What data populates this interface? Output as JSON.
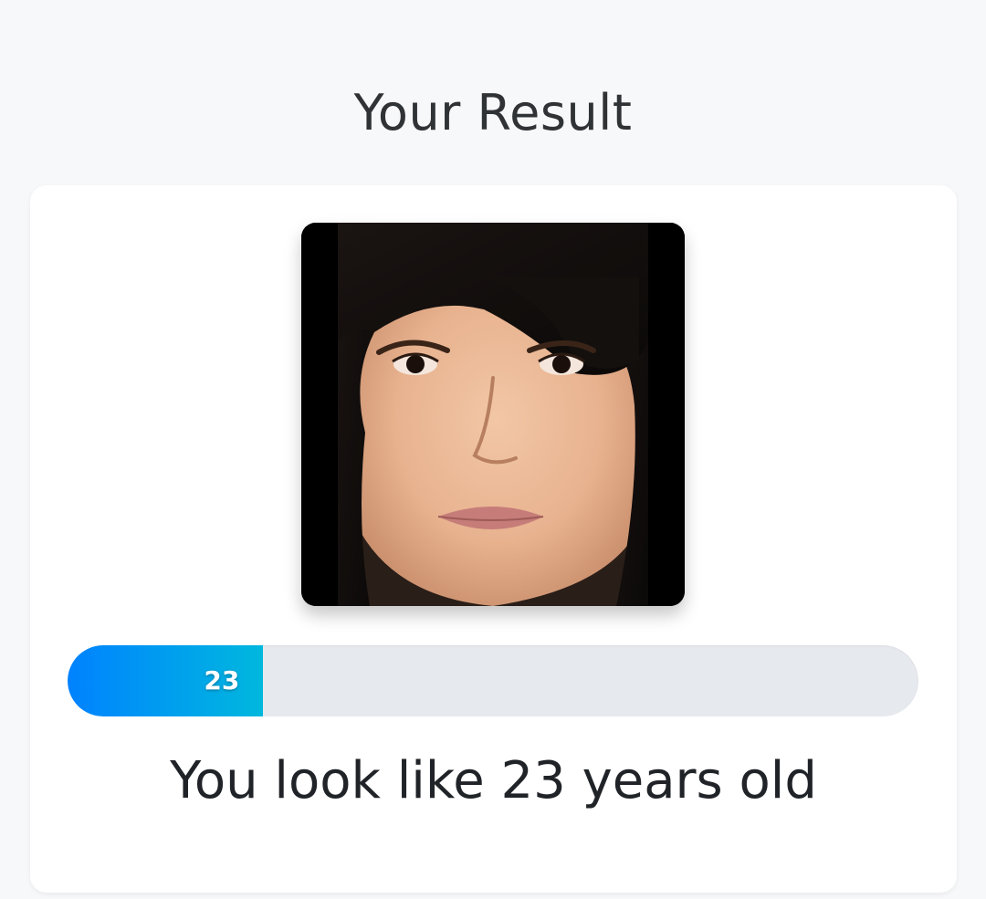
{
  "header": {
    "title": "Your Result"
  },
  "result": {
    "photo_alt": "Face photo",
    "estimated_age": 23,
    "age_label": "23",
    "age_fraction": 0.23,
    "message": "You look like 23 years old"
  },
  "colors": {
    "background": "#f7f8fa",
    "card": "#ffffff",
    "track": "#e6e9ed",
    "fill_start": "#0082ff",
    "fill_end": "#00b8de",
    "text_dark": "#202327"
  }
}
